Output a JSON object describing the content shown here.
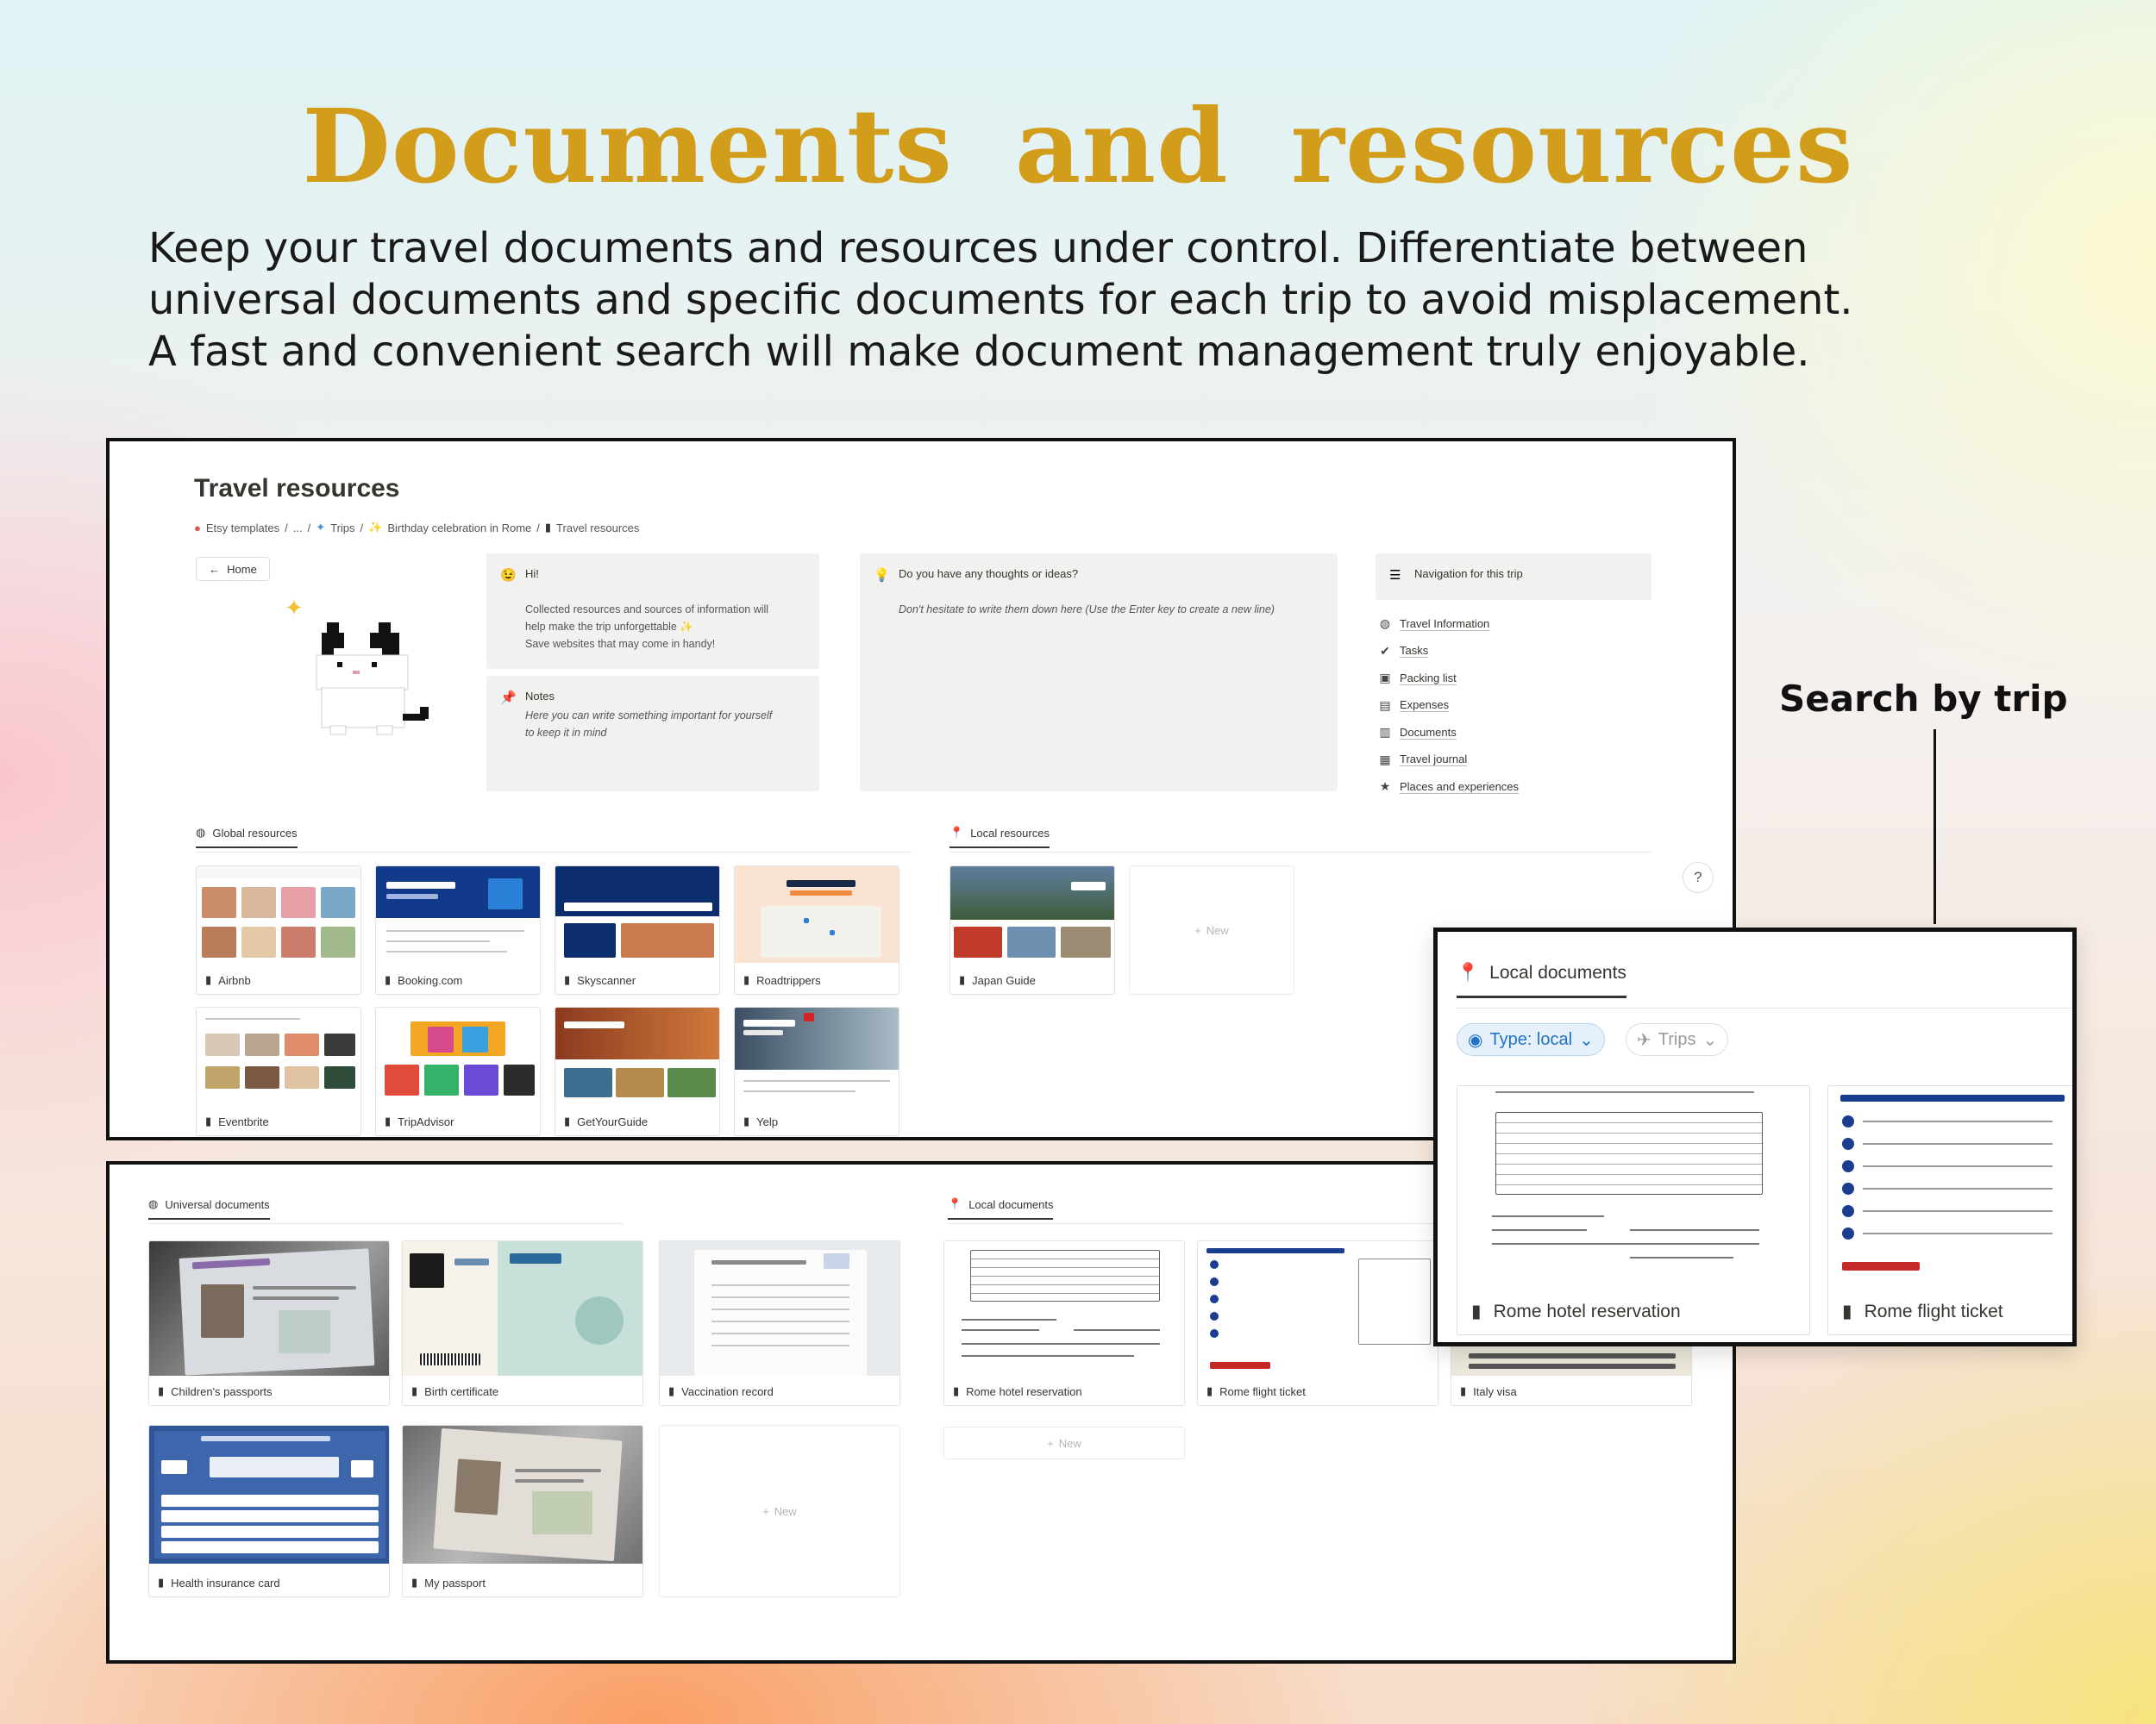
{
  "header": {
    "title": "Documents and resources",
    "subtitle_lines": [
      "Keep your travel documents and resources under control. Differentiate between",
      "universal documents and specific documents for each trip to avoid misplacement.",
      "A fast and convenient search will make document management truly enjoyable."
    ]
  },
  "callout_label": "Search by trip",
  "page": {
    "title": "Travel resources",
    "breadcrumbs": [
      "Etsy templates",
      "...",
      "Trips",
      "Birthday celebration in Rome",
      "Travel resources"
    ],
    "home_label": "Home",
    "hi": {
      "title": "Hi!",
      "line1": "Collected resources and sources of information will",
      "line2": "help make the trip unforgettable ✨",
      "line3": "Save websites that may come in handy!"
    },
    "notes": {
      "title": "Notes",
      "line1": "Here you can write something important for yourself",
      "line2": "to keep it in mind"
    },
    "thoughts": {
      "title": "Do you have any thoughts or ideas?",
      "body": "Don't hesitate to write them down here (Use the Enter key to create a new line)"
    },
    "nav": {
      "title": "Navigation for this trip",
      "items": [
        {
          "label": "Travel Information",
          "icon": "globe-icon"
        },
        {
          "label": "Tasks",
          "icon": "checklist-icon"
        },
        {
          "label": "Packing list",
          "icon": "suitcase-icon"
        },
        {
          "label": "Expenses",
          "icon": "wallet-icon"
        },
        {
          "label": "Documents",
          "icon": "document-icon"
        },
        {
          "label": "Travel journal",
          "icon": "journal-icon"
        },
        {
          "label": "Places and experiences",
          "icon": "star-icon"
        }
      ]
    },
    "global_resources": {
      "label": "Global resources",
      "items": [
        "Airbnb",
        "Booking.com",
        "Skyscanner",
        "Roadtrippers",
        "Eventbrite",
        "TripAdvisor",
        "GetYourGuide",
        "Yelp"
      ]
    },
    "local_resources": {
      "label": "Local resources",
      "items": [
        "Japan Guide"
      ],
      "new_label": "New"
    },
    "help_label": "?"
  },
  "docs": {
    "universal": {
      "label": "Universal documents",
      "items": [
        "Children's passports",
        "Birth certificate",
        "Vaccination record",
        "Health insurance card",
        "My passport"
      ],
      "new_label": "New"
    },
    "local": {
      "label": "Local documents",
      "items": [
        "Rome hotel reservation",
        "Rome flight ticket",
        "Italy visa"
      ],
      "new_label": "New"
    }
  },
  "overlay": {
    "label": "Local documents",
    "filter_type": "Type: local",
    "filter_trips": "Trips",
    "items": [
      "Rome hotel reservation",
      "Rome flight ticket"
    ]
  },
  "colors": {
    "title_gold": "#d39d1c",
    "chip_blue": "#1f73c4",
    "callout_bg": "#f1f1ef"
  }
}
